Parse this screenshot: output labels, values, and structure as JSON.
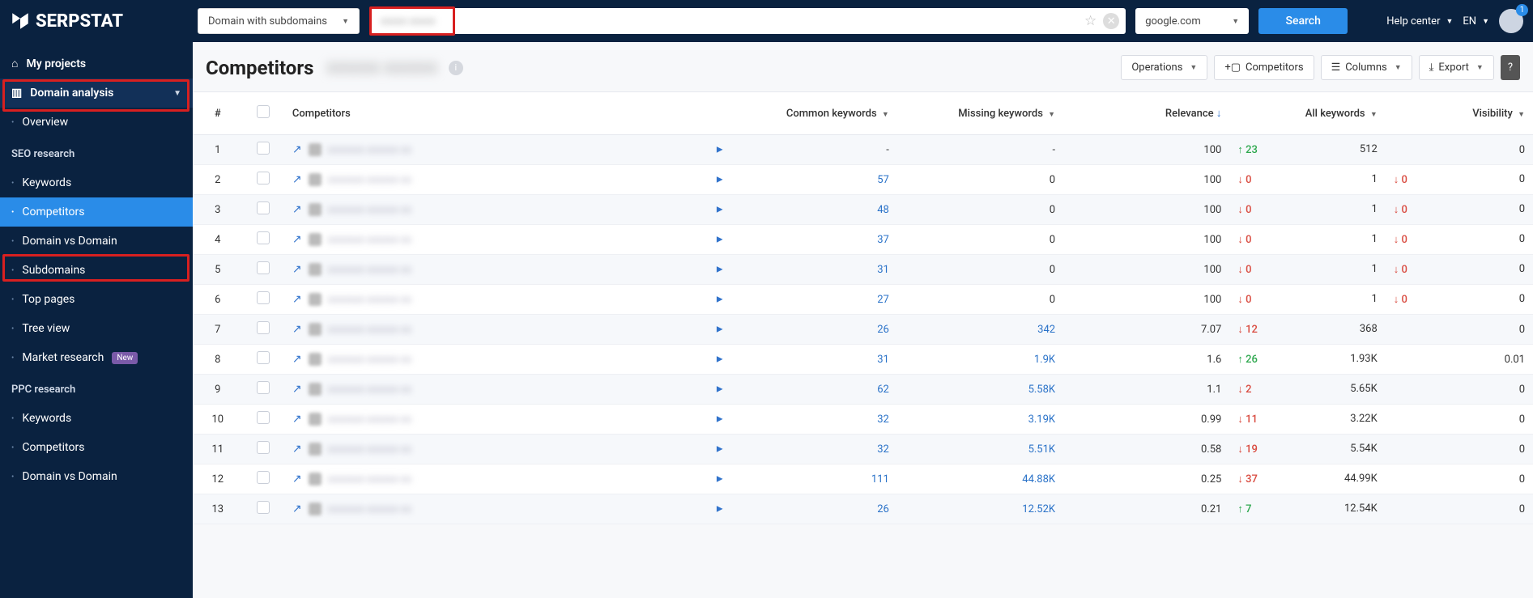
{
  "header": {
    "logo": "SERPSTAT",
    "domain_selector": "Domain with subdomains",
    "search_value": "(blurred)",
    "se_label": "google.com",
    "search_btn": "Search",
    "help_label": "Help center",
    "lang_label": "EN",
    "notif_count": "1"
  },
  "sidebar": {
    "my_projects": "My projects",
    "domain_analysis": "Domain analysis",
    "overview": "Overview",
    "seo_research": "SEO research",
    "keywords": "Keywords",
    "competitors": "Competitors",
    "dvd": "Domain vs Domain",
    "subdomains": "Subdomains",
    "top_pages": "Top pages",
    "tree_view": "Tree view",
    "market_research": "Market research",
    "new_badge": "New",
    "ppc_research": "PPC research",
    "ppc_keywords": "Keywords",
    "ppc_competitors": "Competitors",
    "ppc_dvd": "Domain vs Domain"
  },
  "toolbar": {
    "title": "Competitors",
    "operations": "Operations",
    "competitors_btn": "Competitors",
    "columns": "Columns",
    "export": "Export"
  },
  "columns": {
    "num": "#",
    "competitors": "Competitors",
    "common": "Common keywords",
    "missing": "Missing keywords",
    "relevance": "Relevance",
    "all": "All keywords",
    "visibility": "Visibility"
  },
  "rows": [
    {
      "n": "1",
      "common": "-",
      "missing": "-",
      "rel": "100",
      "ak_delta": "23",
      "ak_dir": "up",
      "ak": "512",
      "vis_delta": "",
      "vis_dir": "",
      "vis": "0"
    },
    {
      "n": "2",
      "common": "57",
      "missing": "0",
      "rel": "100",
      "ak_delta": "0",
      "ak_dir": "down",
      "ak": "1",
      "vis_delta": "0",
      "vis_dir": "down",
      "vis": "0"
    },
    {
      "n": "3",
      "common": "48",
      "missing": "0",
      "rel": "100",
      "ak_delta": "0",
      "ak_dir": "down",
      "ak": "1",
      "vis_delta": "0",
      "vis_dir": "down",
      "vis": "0"
    },
    {
      "n": "4",
      "common": "37",
      "missing": "0",
      "rel": "100",
      "ak_delta": "0",
      "ak_dir": "down",
      "ak": "1",
      "vis_delta": "0",
      "vis_dir": "down",
      "vis": "0"
    },
    {
      "n": "5",
      "common": "31",
      "missing": "0",
      "rel": "100",
      "ak_delta": "0",
      "ak_dir": "down",
      "ak": "1",
      "vis_delta": "0",
      "vis_dir": "down",
      "vis": "0"
    },
    {
      "n": "6",
      "common": "27",
      "missing": "0",
      "rel": "100",
      "ak_delta": "0",
      "ak_dir": "down",
      "ak": "1",
      "vis_delta": "0",
      "vis_dir": "down",
      "vis": "0"
    },
    {
      "n": "7",
      "common": "26",
      "missing": "342",
      "rel": "7.07",
      "ak_delta": "12",
      "ak_dir": "down",
      "ak": "368",
      "vis_delta": "",
      "vis_dir": "",
      "vis": "0"
    },
    {
      "n": "8",
      "common": "31",
      "missing": "1.9K",
      "rel": "1.6",
      "ak_delta": "26",
      "ak_dir": "up",
      "ak": "1.93K",
      "vis_delta": "",
      "vis_dir": "",
      "vis": "0.01"
    },
    {
      "n": "9",
      "common": "62",
      "missing": "5.58K",
      "rel": "1.1",
      "ak_delta": "2",
      "ak_dir": "down",
      "ak": "5.65K",
      "vis_delta": "",
      "vis_dir": "",
      "vis": "0"
    },
    {
      "n": "10",
      "common": "32",
      "missing": "3.19K",
      "rel": "0.99",
      "ak_delta": "11",
      "ak_dir": "down",
      "ak": "3.22K",
      "vis_delta": "",
      "vis_dir": "",
      "vis": "0"
    },
    {
      "n": "11",
      "common": "32",
      "missing": "5.51K",
      "rel": "0.58",
      "ak_delta": "19",
      "ak_dir": "down",
      "ak": "5.54K",
      "vis_delta": "",
      "vis_dir": "",
      "vis": "0"
    },
    {
      "n": "12",
      "common": "111",
      "missing": "44.88K",
      "rel": "0.25",
      "ak_delta": "37",
      "ak_dir": "down",
      "ak": "44.99K",
      "vis_delta": "",
      "vis_dir": "",
      "vis": "0"
    },
    {
      "n": "13",
      "common": "26",
      "missing": "12.52K",
      "rel": "0.21",
      "ak_delta": "7",
      "ak_dir": "up",
      "ak": "12.54K",
      "vis_delta": "",
      "vis_dir": "",
      "vis": "0"
    }
  ]
}
